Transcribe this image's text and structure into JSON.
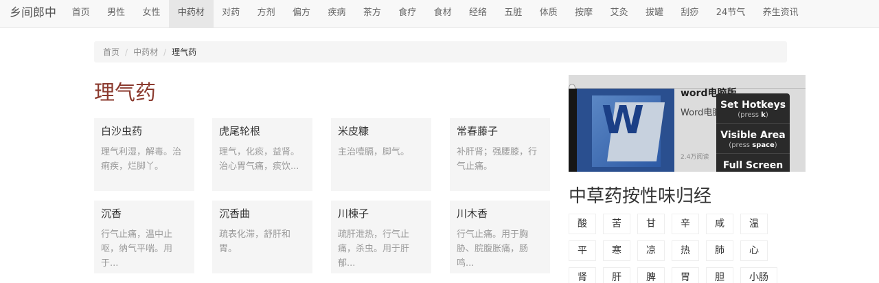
{
  "brand": "乡间郎中",
  "nav": [
    "首页",
    "男性",
    "女性",
    "中药材",
    "对药",
    "方剂",
    "偏方",
    "疾病",
    "茶方",
    "食疗",
    "食材",
    "经络",
    "五脏",
    "体质",
    "按摩",
    "艾灸",
    "拔罐",
    "刮痧",
    "24节气",
    "养生资讯"
  ],
  "nav_active": "中药材",
  "breadcrumb": {
    "home": "首页",
    "section": "中药材",
    "current": "理气药",
    "sep": "/"
  },
  "page_title": "理气药",
  "cards": [
    {
      "title": "白沙虫药",
      "desc": "理气利湿，解毒。治痢疾，烂脚丫。"
    },
    {
      "title": "虎尾轮根",
      "desc": "理气，化痰，益肾。治心胃气痛，痰饮..."
    },
    {
      "title": "米皮糠",
      "desc": "主治噎膈，脚气。"
    },
    {
      "title": "常春藤子",
      "desc": "补肝肾；强腰膝，行气止痛。"
    },
    {
      "title": "沉香",
      "desc": "行气止痛，温中止呕，纳气平喘。用于..."
    },
    {
      "title": "沉香曲",
      "desc": "疏表化滞，舒肝和胃。"
    },
    {
      "title": "川楝子",
      "desc": "疏肝泄热，行气止痛，杀虫。用于肝郁..."
    },
    {
      "title": "川木香",
      "desc": "行气止痛。用于胸胁、脘腹胀痛，肠鸣..."
    }
  ],
  "ad": {
    "title": "word电脑版",
    "subtitle": "Word电脑",
    "reads": "2.4万阅读",
    "logo_letter": "W"
  },
  "hotkeys": [
    {
      "label": "Set Hotkeys",
      "hint_pre": "(press ",
      "key": "k",
      "hint_post": ")"
    },
    {
      "label": "Visible Area",
      "hint_pre": "(press ",
      "key": "space",
      "hint_post": ")"
    },
    {
      "label": "Full Screen",
      "hint_pre": "",
      "key": "",
      "hint_post": ""
    }
  ],
  "side_title": "中草药按性味归经",
  "tags": [
    "酸",
    "苦",
    "甘",
    "辛",
    "咸",
    "温",
    "平",
    "寒",
    "凉",
    "热",
    "肺",
    "心",
    "肾",
    "肝",
    "脾",
    "胃",
    "胆",
    "小肠"
  ],
  "colors": {
    "title_accent": "#8b3a2e",
    "card_bg": "#f5f5f5",
    "nav_bg": "#f8f8f8",
    "nav_active_bg": "#e7e7e7"
  }
}
